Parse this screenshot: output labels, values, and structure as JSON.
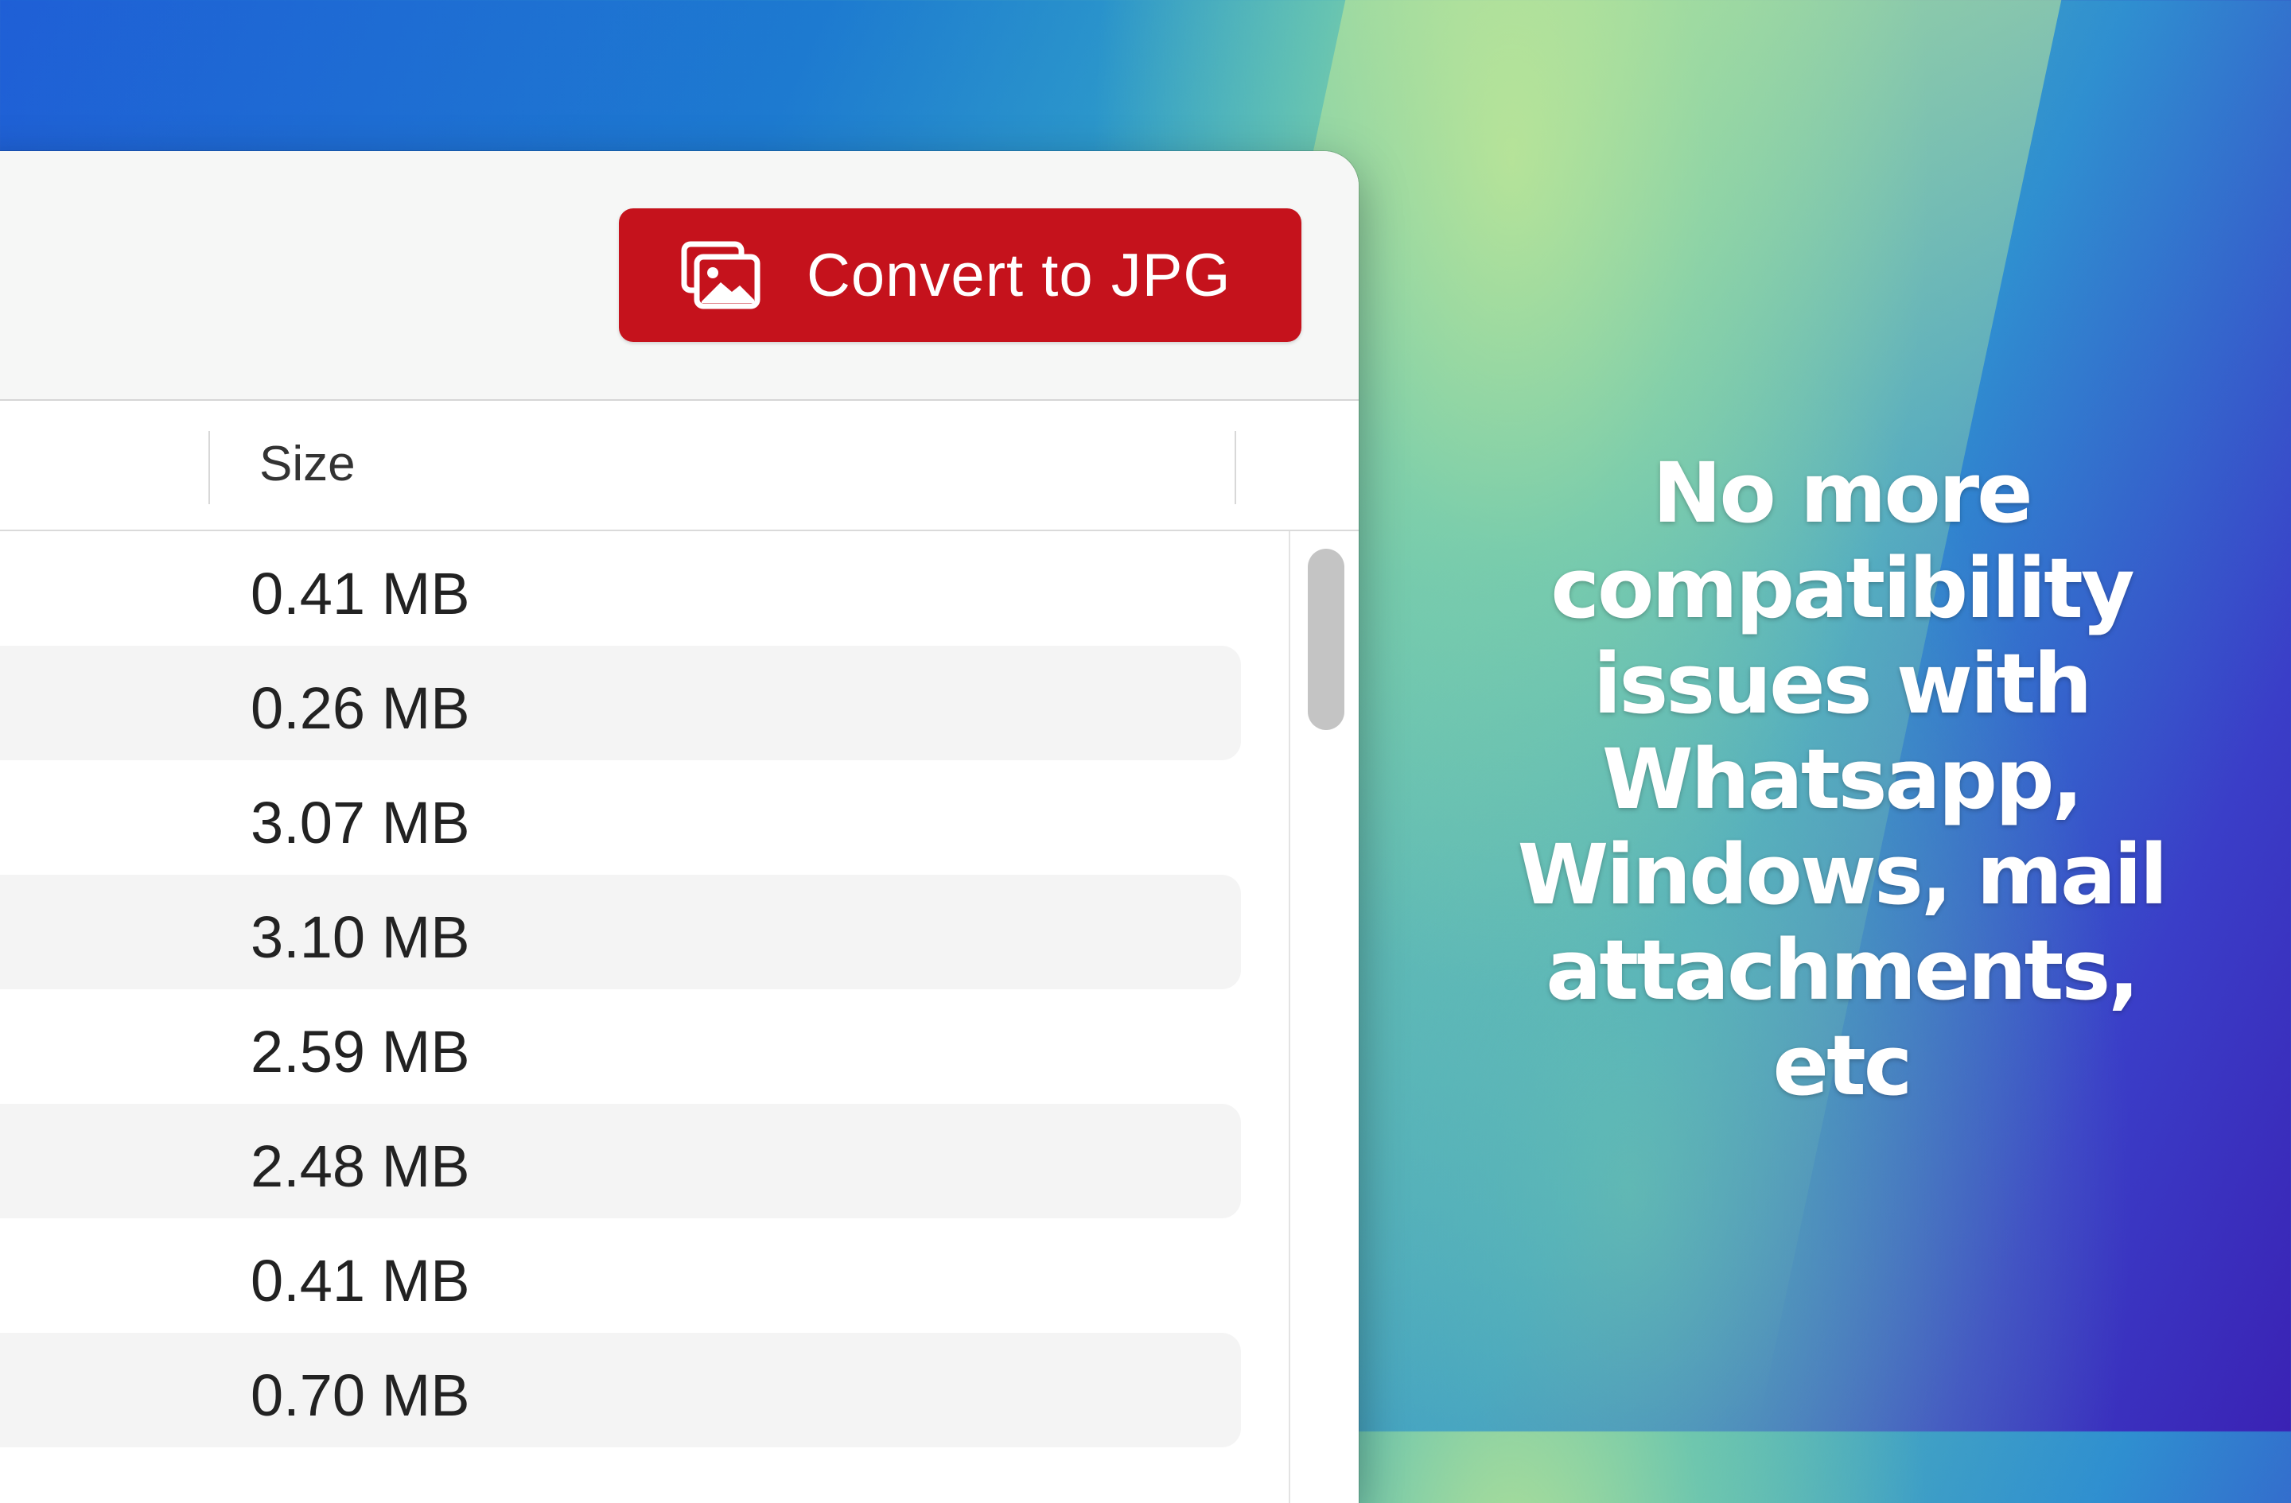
{
  "toolbar": {
    "convert_label": "Convert to JPG"
  },
  "table": {
    "columns": [
      "Size"
    ],
    "rows": [
      {
        "size": "0.41 MB"
      },
      {
        "size": "0.26 MB"
      },
      {
        "size": "3.07 MB"
      },
      {
        "size": "3.10 MB"
      },
      {
        "size": "2.59 MB"
      },
      {
        "size": "2.48 MB"
      },
      {
        "size": "0.41 MB"
      },
      {
        "size": "0.70 MB"
      }
    ]
  },
  "promo": {
    "lines": [
      "No more",
      "compatibility",
      "issues with",
      "Whatsapp,",
      "Windows, mail",
      "attachments, etc"
    ]
  },
  "colors": {
    "accent_red": "#c5121c"
  },
  "icons": {
    "convert": "image-stack-icon"
  }
}
